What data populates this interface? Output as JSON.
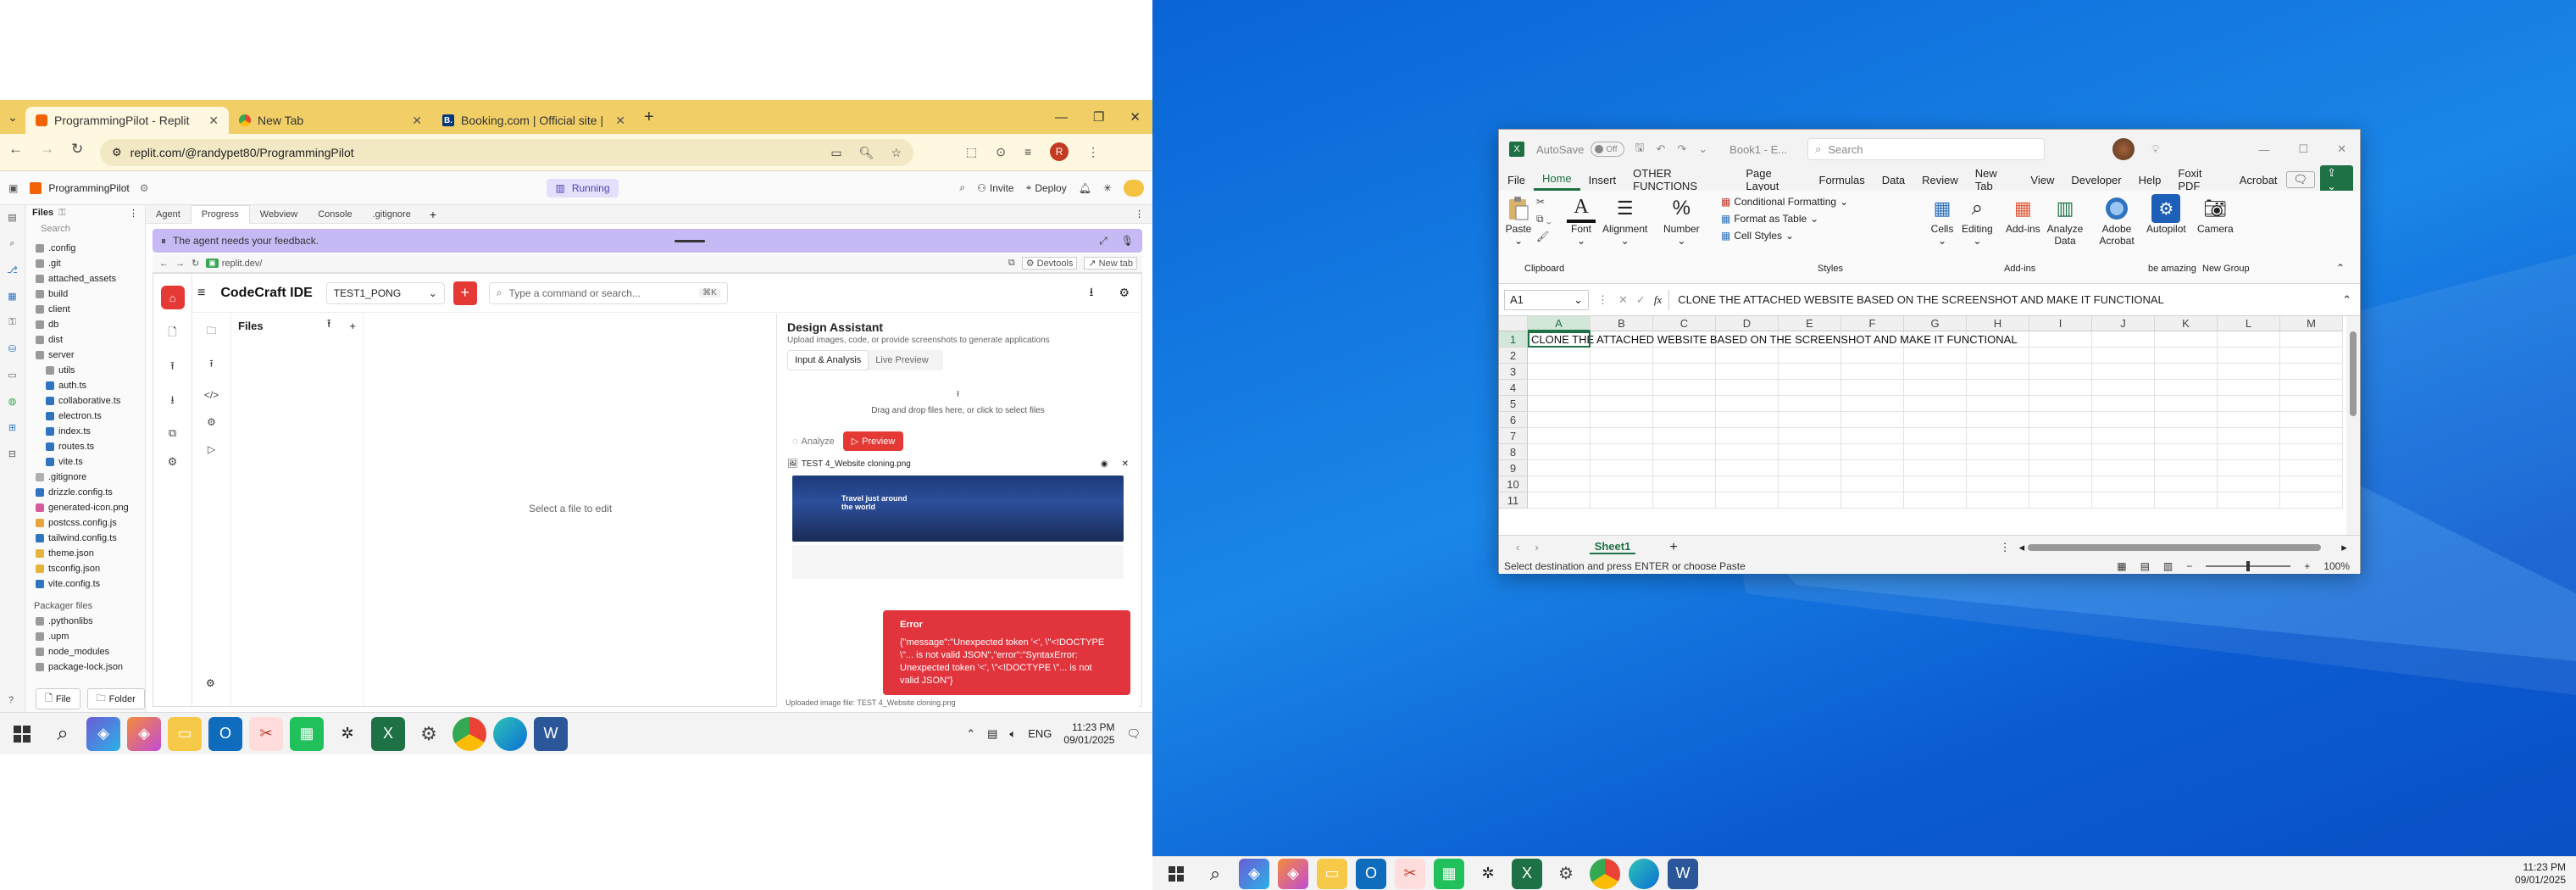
{
  "left": {
    "browser": {
      "tabs": [
        {
          "label": "ProgrammingPilot - Replit"
        },
        {
          "label": "New Tab"
        },
        {
          "label": "Booking.com | Official site | The"
        }
      ],
      "url": "replit.com/@randypet80/ProgrammingPilot",
      "profile_initial": "R"
    },
    "replit": {
      "project": "ProgrammingPilot",
      "status": "Running",
      "invite": "Invite",
      "deploy": "Deploy",
      "files_title": "Files",
      "search_placeholder": "Search",
      "tree": [
        {
          "name": ".config",
          "color": "#9a9a9a"
        },
        {
          "name": ".git",
          "color": "#9a9a9a"
        },
        {
          "name": "attached_assets",
          "color": "#9a9a9a"
        },
        {
          "name": "build",
          "color": "#9a9a9a"
        },
        {
          "name": "client",
          "color": "#9a9a9a"
        },
        {
          "name": "db",
          "color": "#9a9a9a"
        },
        {
          "name": "dist",
          "color": "#9a9a9a"
        },
        {
          "name": "server",
          "color": "#9a9a9a"
        },
        {
          "name": "utils",
          "color": "#9a9a9a"
        },
        {
          "name": "auth.ts",
          "color": "#2f74c0"
        },
        {
          "name": "collaborative.ts",
          "color": "#2f74c0"
        },
        {
          "name": "electron.ts",
          "color": "#2f74c0"
        },
        {
          "name": "index.ts",
          "color": "#2f74c0"
        },
        {
          "name": "routes.ts",
          "color": "#2f74c0"
        },
        {
          "name": "vite.ts",
          "color": "#2f74c0"
        },
        {
          "name": ".gitignore",
          "color": "#b0b0b0"
        },
        {
          "name": "drizzle.config.ts",
          "color": "#2f74c0"
        },
        {
          "name": "generated-icon.png",
          "color": "#d45c9b"
        },
        {
          "name": "postcss.config.js",
          "color": "#e8a33b"
        },
        {
          "name": "tailwind.config.ts",
          "color": "#2f74c0"
        },
        {
          "name": "theme.json",
          "color": "#e8b33b"
        },
        {
          "name": "tsconfig.json",
          "color": "#e8b33b"
        },
        {
          "name": "vite.config.ts",
          "color": "#2f74c0"
        }
      ],
      "packager_title": "Packager files",
      "packager": [
        {
          "name": ".pythonlibs"
        },
        {
          "name": ".upm"
        },
        {
          "name": "node_modules"
        },
        {
          "name": "package-lock.json"
        }
      ],
      "file_btn": "File",
      "folder_btn": "Folder",
      "tabs": [
        {
          "label": "Agent"
        },
        {
          "label": "Progress"
        },
        {
          "label": "Webview"
        },
        {
          "label": "Console"
        },
        {
          "label": ".gitignore"
        }
      ],
      "agent_message": "The agent needs your feedback.",
      "webview_url": "replit.dev/",
      "devtools": "Devtools",
      "new_tab": "New tab",
      "app": {
        "name": "CodeCraft IDE",
        "project_select": "TEST1_PONG",
        "command_placeholder": "Type a command or search...",
        "shortcut": "⌘K",
        "files": "Files",
        "empty_editor": "Select a file to edit"
      },
      "assistant": {
        "title": "Design Assistant",
        "subtitle": "Upload images, code, or provide screenshots to generate applications",
        "tab_input": "Input & Analysis",
        "tab_preview": "Live Preview",
        "dropzone": "Drag and drop files here, or click to select files",
        "analyze": "Analyze",
        "preview": "Preview",
        "file_name": "TEST 4_Website cloning.png",
        "footer": "Uploaded image file: TEST 4_Website cloning.png",
        "thumb_headline": "Travel just around the world"
      },
      "error": {
        "title": "Error",
        "message": "{\"message\":\"Unexpected token '<', \\\"<!DOCTYPE \\\"... is not valid JSON\",\"error\":\"SyntaxError: Unexpected token '<', \\\"<!DOCTYPE \\\"... is not valid JSON\"}"
      }
    },
    "taskbar": {
      "time": "11:23 PM",
      "date": "09/01/2025",
      "lang": "ENG"
    }
  },
  "right": {
    "excel": {
      "autosave": "AutoSave",
      "autosave_state": "Off",
      "title": "Book1 - E...",
      "search_placeholder": "Search",
      "menu": [
        "File",
        "Home",
        "Insert",
        "OTHER FUNCTIONS",
        "Page Layout",
        "Formulas",
        "Data",
        "Review",
        "New Tab",
        "View",
        "Developer",
        "Help",
        "Foxit PDF",
        "Acrobat"
      ],
      "ribbon": {
        "paste": "Paste",
        "clipboard": "Clipboard",
        "font": "Font",
        "alignment": "Alignment",
        "number": "Number",
        "conditional": "Conditional Formatting",
        "format_table": "Format as Table",
        "cell_styles": "Cell Styles",
        "styles": "Styles",
        "cells": "Cells",
        "editing": "Editing",
        "addins": "Add-ins",
        "addins_group": "Add-ins",
        "analyze": "Analyze Data",
        "adobe": "Adobe Acrobat",
        "autopilot": "Autopilot",
        "camera": "Camera",
        "be_amazing": "be amazing",
        "new_group": "New Group"
      },
      "name_box": "A1",
      "formula": "CLONE THE ATTACHED WEBSITE BASED  ON THE SCREENSHOT AND MAKE IT FUNCTIONAL",
      "columns": [
        "A",
        "B",
        "C",
        "D",
        "E",
        "F",
        "G",
        "H",
        "I",
        "J",
        "K",
        "L",
        "M"
      ],
      "rows": [
        "1",
        "2",
        "3",
        "4",
        "5",
        "6",
        "7",
        "8",
        "9",
        "10",
        "11"
      ],
      "cell_a1": "CLONE THE ATTACHED WEBSITE BASED  ON THE SCREENSHOT AND MAKE IT FUNCTIONAL",
      "sheet": "Sheet1",
      "status": "Select destination and press ENTER or choose Paste",
      "zoom": "100%"
    },
    "taskbar": {
      "time": "11:23 PM",
      "date": "09/01/2025"
    }
  }
}
